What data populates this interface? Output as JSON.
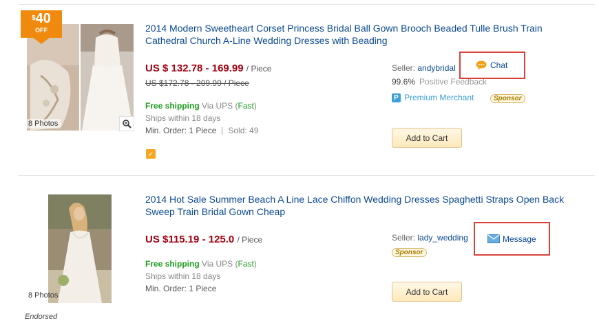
{
  "listings": [
    {
      "discount_badge": {
        "currency": "$",
        "amount": "40",
        "label": "OFF"
      },
      "photos_count": "8 Photos",
      "title": "2014 Modern Sweetheart Corset Princess Bridal Ball Gown Brooch Beaded Tulle Brush Train Cathedral Church A-Line Wedding Dresses with Beading",
      "price": "US $ 132.78 - 169.99",
      "price_unit": "/ Piece",
      "old_price": "US $172.78 - 209.99 / Piece",
      "shipping": {
        "free": "Free shipping",
        "via": "Via UPS (",
        "carrier": "Fast",
        "close": ")"
      },
      "ships_within": "Ships within 18 days",
      "min_order": "Min. Order: 1 Piece",
      "sold": "Sold: 49",
      "seller_label": "Seller:",
      "seller_name": "andybridal",
      "feedback_pct": "99.6%",
      "feedback_label": "Positive Feedback",
      "premium_label": "Premium Merchant",
      "sponsor": "Sponsor",
      "contact_label": "Chat",
      "cart_label": "Add to Cart"
    },
    {
      "photos_count": "8 Photos",
      "title": "2014 Hot Sale Summer Beach A Line Lace Chiffon Wedding Dresses Spaghetti Straps Open Back Sweep Train Bridal Gown Cheap",
      "price": "US $115.19 - 125.0",
      "price_unit": "/ Piece",
      "shipping": {
        "free": "Free shipping",
        "via": "Via UPS (",
        "carrier": "Fast",
        "close": ")"
      },
      "ships_within": "Ships within 18 days",
      "min_order": "Min. Order: 1 Piece",
      "seller_label": "Seller:",
      "seller_name": "lady_wedding",
      "sponsor": "Sponsor",
      "contact_label": "Message",
      "cart_label": "Add to Cart",
      "endorsed": "Endorsed"
    }
  ],
  "icons": {
    "chat": "chat-bubble-icon",
    "message": "envelope-icon",
    "zoom": "magnifier-icon",
    "premium": "p-badge-icon",
    "verified": "checkmark-badge-icon"
  },
  "colors": {
    "title_link": "#0b4a91",
    "price": "#a30010",
    "free_shipping": "#1e9d1e",
    "highlight_box": "#d9413a",
    "badge": "#f08a0e"
  }
}
